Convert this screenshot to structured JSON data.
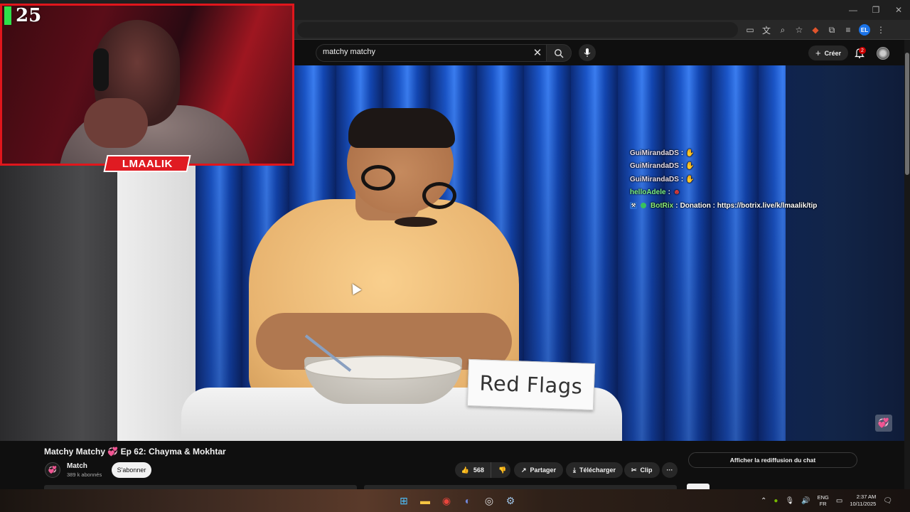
{
  "youtube": {
    "search_query": "matchy matchy",
    "create_label": "Créer",
    "notification_count": "2"
  },
  "overlay": {
    "counter": "25",
    "streamer_name": "LMAALIK",
    "chat": [
      {
        "user": "GuiMirandaDS",
        "sep": ":",
        "message": "",
        "emote": "hand-emote"
      },
      {
        "user": "GuiMirandaDS",
        "sep": ":",
        "message": "",
        "emote": "hand-emote"
      },
      {
        "user": "GuiMirandaDS",
        "sep": ":",
        "message": "",
        "emote": "hand-emote"
      },
      {
        "user": "helloAdele",
        "sep": ":",
        "message": "",
        "emote": "devil-emote"
      },
      {
        "user": "BotRix",
        "sep": ":",
        "message": "Donation : https://botrix.live/k/lmaalik/tip",
        "emote": ""
      }
    ]
  },
  "video_scene": {
    "sign_text": "Red Flags"
  },
  "video_info": {
    "title": "Matchy Matchy 💞 Ep 62: Chayma & Mokhtar",
    "channel_name": "Match",
    "subscribers": "389 k abonnés",
    "subscribe_label": "S'abonner",
    "likes": "568",
    "share_label": "Partager",
    "download_label": "Télécharger",
    "clip_label": "Clip",
    "more_label": "···",
    "chat_replay_label": "Afficher la rediffusion du chat"
  },
  "taskbar": {
    "lang_top": "ENG",
    "lang_bottom": "FR",
    "time": "2:37 AM",
    "date": "10/11/2025"
  },
  "colors": {
    "webcam_border": "#e0161c",
    "name_tag": "#e01b22",
    "counter_accent": "#2ee04a",
    "chat_name_green": "#7cf48c"
  }
}
